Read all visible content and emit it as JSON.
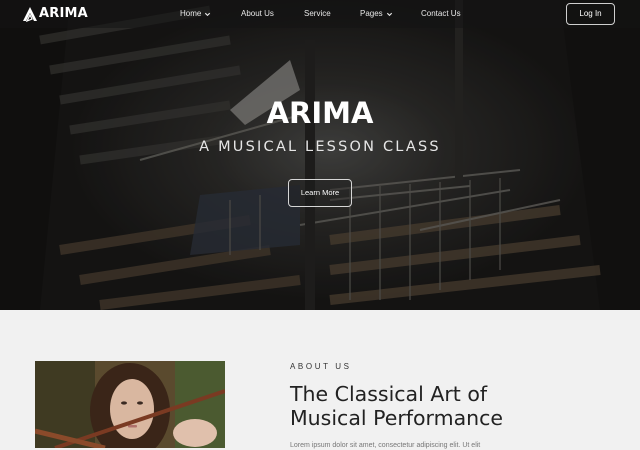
{
  "brand": {
    "name": "ARIMA"
  },
  "nav": {
    "items": [
      {
        "label": "Home",
        "has_dropdown": true
      },
      {
        "label": "About Us",
        "has_dropdown": false
      },
      {
        "label": "Service",
        "has_dropdown": false
      },
      {
        "label": "Pages",
        "has_dropdown": true
      },
      {
        "label": "Contact Us",
        "has_dropdown": false
      }
    ],
    "login_label": "Log In"
  },
  "hero": {
    "title": "ARIMA",
    "subtitle": "A MUSICAL LESSON CLASS",
    "cta_label": "Learn More"
  },
  "about": {
    "label": "ABOUT US",
    "title_line1": "The Classical Art of",
    "title_line2": "Musical Performance",
    "text": "Lorem ipsum dolor sit amet, consectetur adipiscing elit. Ut elit"
  },
  "colors": {
    "hero_dark": "#191817",
    "page_bg": "#f1f1f1",
    "nav_text": "#e8e8e8",
    "heading": "#222222"
  }
}
